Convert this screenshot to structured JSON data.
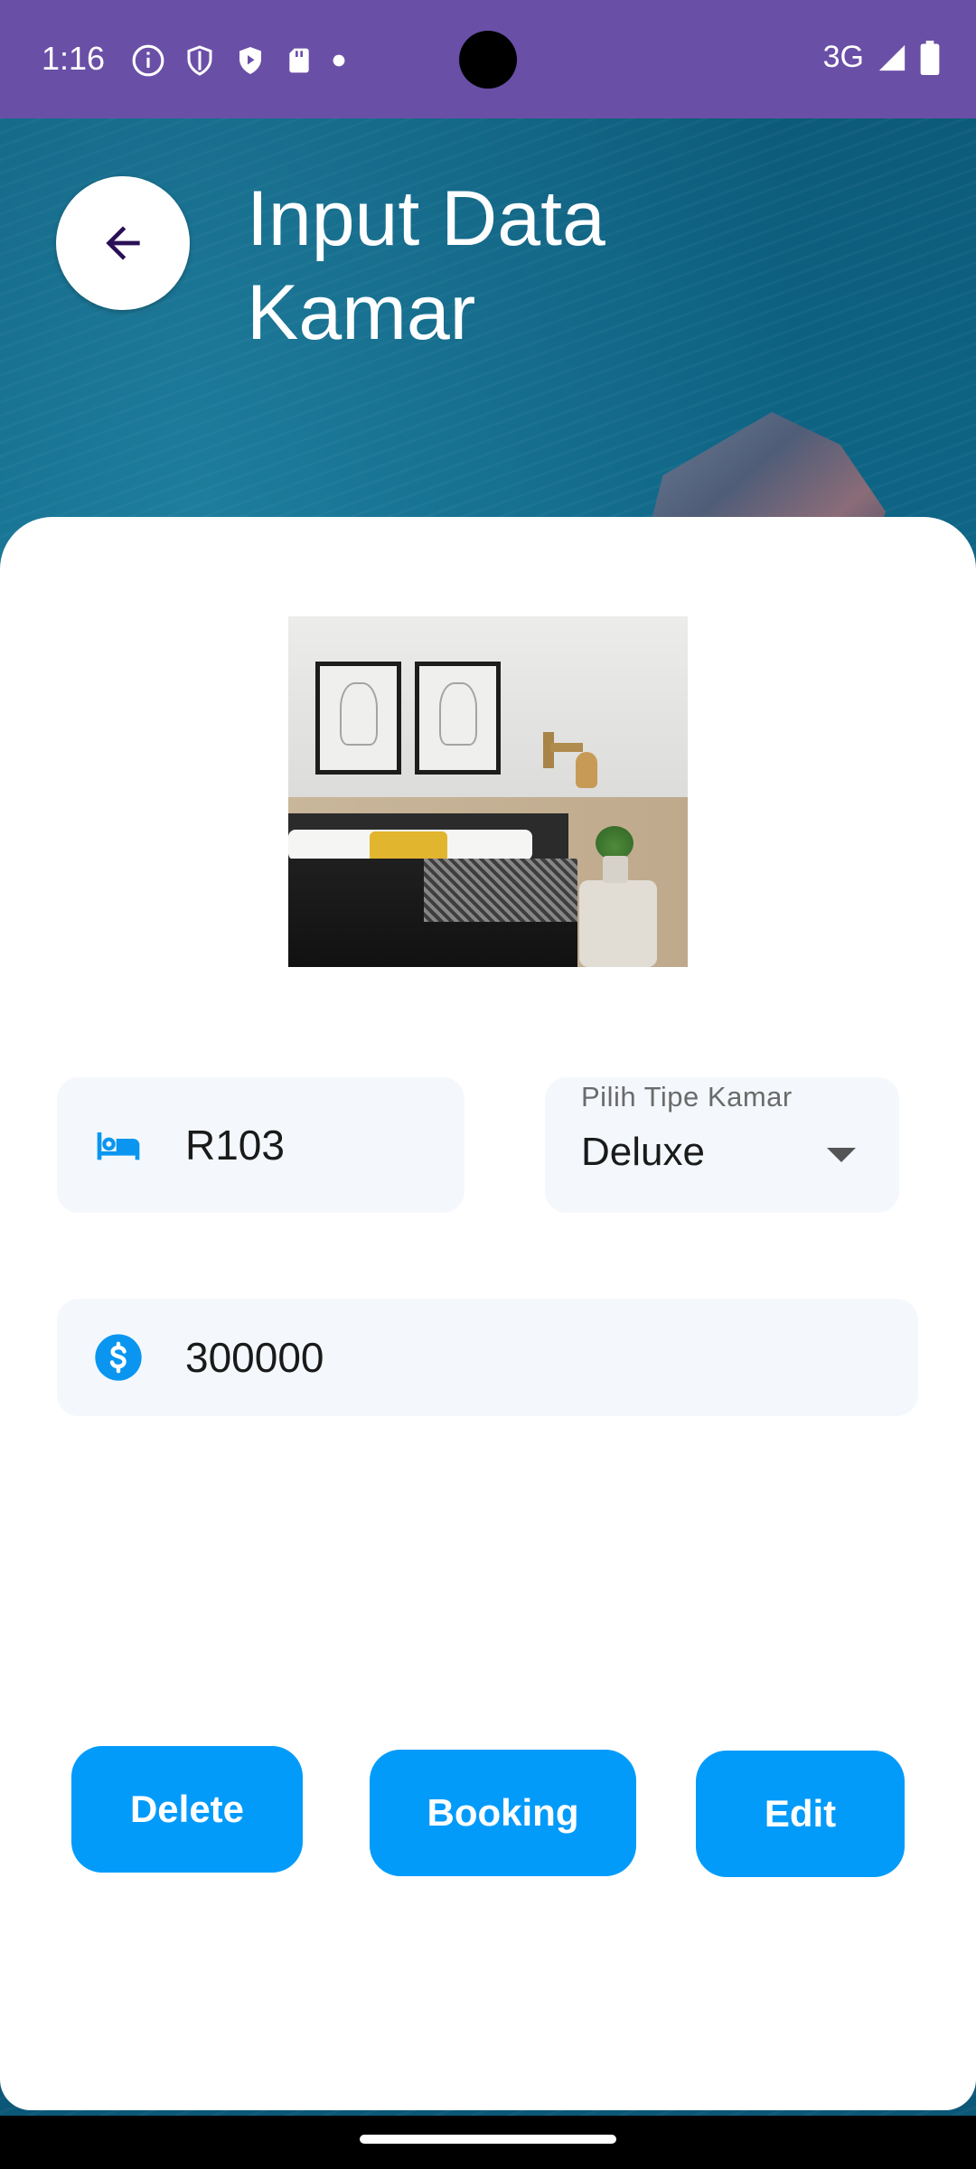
{
  "status_bar": {
    "time": "1:16",
    "network": "3G",
    "icons": [
      "info-icon",
      "shield-icon",
      "play-shield-icon",
      "sd-card-icon",
      "dot-icon",
      "signal-icon",
      "battery-icon"
    ]
  },
  "header": {
    "title": "Input Data Kamar",
    "back_icon": "arrow-left-icon"
  },
  "form": {
    "room_number": {
      "value": "R103",
      "icon": "bed-icon"
    },
    "room_type": {
      "label": "Pilih Tipe Kamar",
      "selected": "Deluxe"
    },
    "price": {
      "value": "300000",
      "icon": "dollar-icon"
    }
  },
  "actions": {
    "delete_label": "Delete",
    "booking_label": "Booking",
    "edit_label": "Edit"
  },
  "colors": {
    "status_bar": "#6a4fa7",
    "accent": "#039bfa",
    "field_bg": "#f4f8fd"
  }
}
